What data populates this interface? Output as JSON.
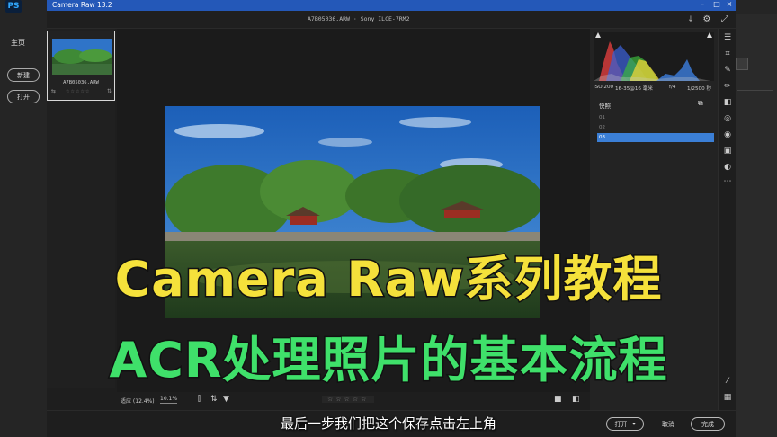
{
  "photoshop": {
    "logo": "PS",
    "home_label": "主页",
    "new_label": "新建",
    "open_label": "打开"
  },
  "acr": {
    "window_title": "Camera Raw 13.2",
    "file_title": "A7B05036.ARW  ·  Sony ILCE-7RM2",
    "thumbnail": {
      "filename": "A7B05036.ARW",
      "stars": "☆☆☆☆☆"
    },
    "bottom_bar": {
      "fit_label": "适应 (12.4%)",
      "zoom_value": "10.1%",
      "rating": "☆☆☆☆☆"
    },
    "exif": {
      "iso": "ISO 200",
      "lens": "16-35@16 毫米",
      "aperture": "f/4",
      "shutter": "1/2500 秒"
    },
    "snapshots": {
      "title": "快照",
      "items": [
        "01",
        "02",
        "03"
      ],
      "selected_index": 2
    },
    "footer": {
      "open_button": "打开",
      "cancel": "取消",
      "done_button": "完成"
    },
    "colors": {
      "titlebar": "#2458b8",
      "selection": "#3b7fd6"
    }
  },
  "overlay": {
    "title_line1": "Camera Raw系列教程",
    "title_line2": "ACR处理照片的基本流程",
    "subtitle": "最后一步我们把这个保存点击左上角"
  }
}
